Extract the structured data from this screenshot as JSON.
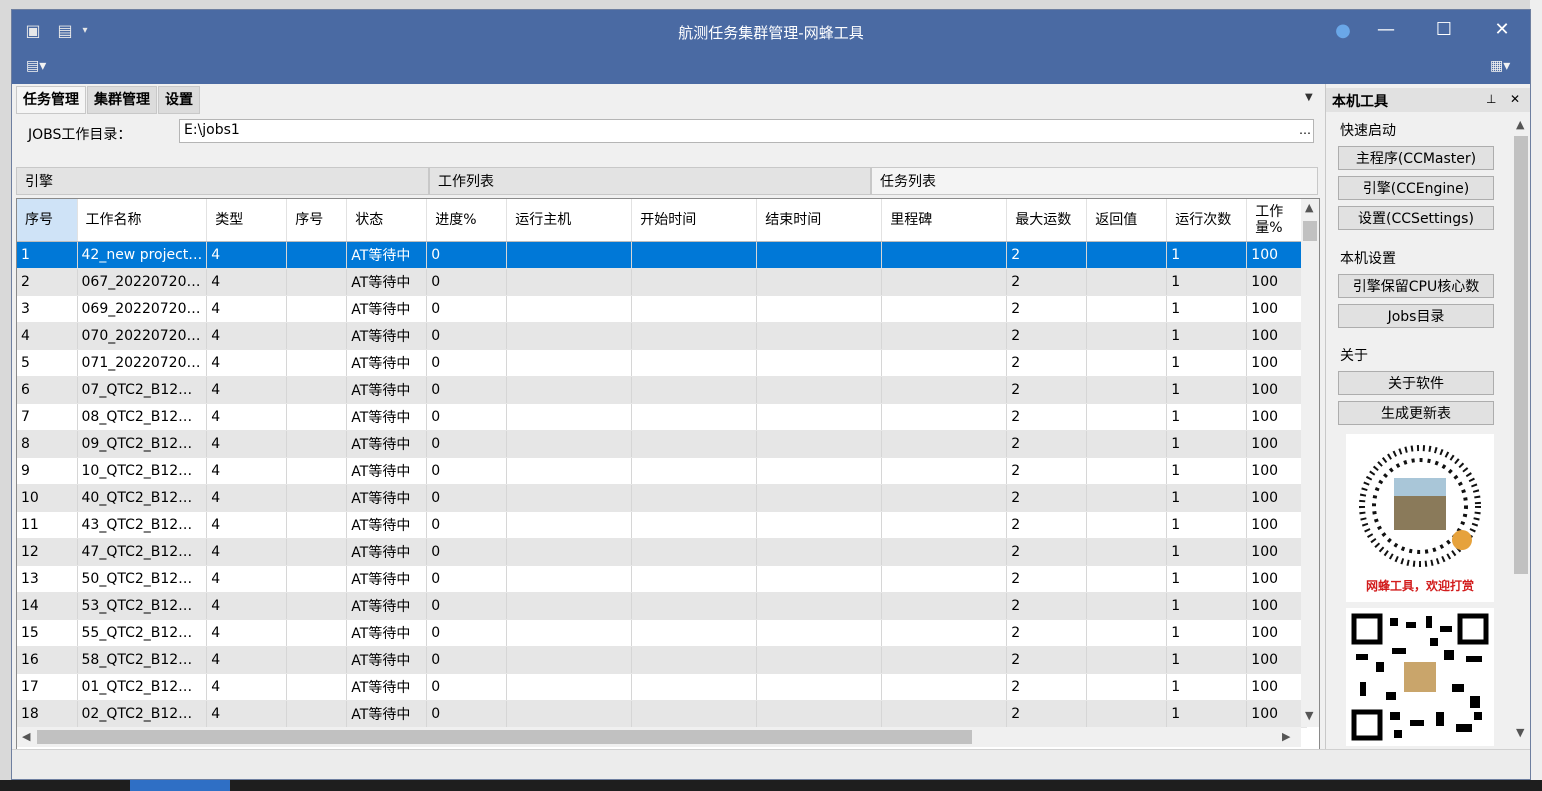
{
  "window": {
    "title": "航测任务集群管理-网蜂工具"
  },
  "tabs": [
    "任务管理",
    "集群管理",
    "设置"
  ],
  "jobs_dir": {
    "label": "JOBS工作目录：",
    "value": "E:\\jobs1",
    "browse": "…"
  },
  "sections": [
    "引擎",
    "工作列表",
    "任务列表"
  ],
  "table": {
    "columns": [
      "序号",
      "工作名称",
      "类型",
      "序号",
      "状态",
      "进度%",
      "运行主机",
      "开始时间",
      "结束时间",
      "里程碑",
      "最大运数",
      "返回值",
      "运行次数",
      "工作量%"
    ],
    "rows": [
      [
        "1",
        "42_new project…",
        "4",
        "",
        "AT等待中",
        "0",
        "",
        "",
        "",
        "",
        "2",
        "",
        "1",
        "100"
      ],
      [
        "2",
        "067_20220720…",
        "4",
        "",
        "AT等待中",
        "0",
        "",
        "",
        "",
        "",
        "2",
        "",
        "1",
        "100"
      ],
      [
        "3",
        "069_20220720…",
        "4",
        "",
        "AT等待中",
        "0",
        "",
        "",
        "",
        "",
        "2",
        "",
        "1",
        "100"
      ],
      [
        "4",
        "070_20220720…",
        "4",
        "",
        "AT等待中",
        "0",
        "",
        "",
        "",
        "",
        "2",
        "",
        "1",
        "100"
      ],
      [
        "5",
        "071_20220720…",
        "4",
        "",
        "AT等待中",
        "0",
        "",
        "",
        "",
        "",
        "2",
        "",
        "1",
        "100"
      ],
      [
        "6",
        "07_QTC2_B12…",
        "4",
        "",
        "AT等待中",
        "0",
        "",
        "",
        "",
        "",
        "2",
        "",
        "1",
        "100"
      ],
      [
        "7",
        "08_QTC2_B12…",
        "4",
        "",
        "AT等待中",
        "0",
        "",
        "",
        "",
        "",
        "2",
        "",
        "1",
        "100"
      ],
      [
        "8",
        "09_QTC2_B12…",
        "4",
        "",
        "AT等待中",
        "0",
        "",
        "",
        "",
        "",
        "2",
        "",
        "1",
        "100"
      ],
      [
        "9",
        "10_QTC2_B12…",
        "4",
        "",
        "AT等待中",
        "0",
        "",
        "",
        "",
        "",
        "2",
        "",
        "1",
        "100"
      ],
      [
        "10",
        "40_QTC2_B12…",
        "4",
        "",
        "AT等待中",
        "0",
        "",
        "",
        "",
        "",
        "2",
        "",
        "1",
        "100"
      ],
      [
        "11",
        "43_QTC2_B12…",
        "4",
        "",
        "AT等待中",
        "0",
        "",
        "",
        "",
        "",
        "2",
        "",
        "1",
        "100"
      ],
      [
        "12",
        "47_QTC2_B12…",
        "4",
        "",
        "AT等待中",
        "0",
        "",
        "",
        "",
        "",
        "2",
        "",
        "1",
        "100"
      ],
      [
        "13",
        "50_QTC2_B12…",
        "4",
        "",
        "AT等待中",
        "0",
        "",
        "",
        "",
        "",
        "2",
        "",
        "1",
        "100"
      ],
      [
        "14",
        "53_QTC2_B12…",
        "4",
        "",
        "AT等待中",
        "0",
        "",
        "",
        "",
        "",
        "2",
        "",
        "1",
        "100"
      ],
      [
        "15",
        "55_QTC2_B12…",
        "4",
        "",
        "AT等待中",
        "0",
        "",
        "",
        "",
        "",
        "2",
        "",
        "1",
        "100"
      ],
      [
        "16",
        "58_QTC2_B12…",
        "4",
        "",
        "AT等待中",
        "0",
        "",
        "",
        "",
        "",
        "2",
        "",
        "1",
        "100"
      ],
      [
        "17",
        "01_QTC2_B12…",
        "4",
        "",
        "AT等待中",
        "0",
        "",
        "",
        "",
        "",
        "2",
        "",
        "1",
        "100"
      ],
      [
        "18",
        "02_QTC2_B12…",
        "4",
        "",
        "AT等待中",
        "0",
        "",
        "",
        "",
        "",
        "2",
        "",
        "1",
        "100"
      ]
    ],
    "selected_row": 0
  },
  "side": {
    "title": "本机工具",
    "group1": {
      "label": "快速启动",
      "buttons": [
        "主程序(CCMaster)",
        "引擎(CCEngine)",
        "设置(CCSettings)"
      ]
    },
    "group2": {
      "label": "本机设置",
      "buttons": [
        "引擎保留CPU核心数",
        "Jobs目录"
      ]
    },
    "group3": {
      "label": "关于",
      "buttons": [
        "关于软件",
        "生成更新表"
      ]
    },
    "qr_caption": "网蜂工具，欢迎打赏"
  }
}
